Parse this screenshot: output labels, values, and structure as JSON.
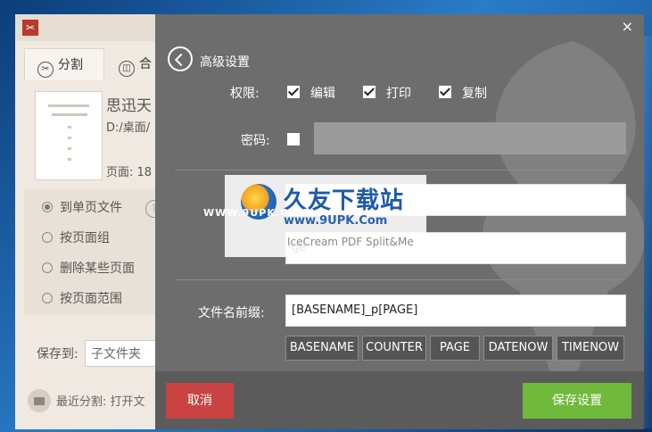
{
  "background_app": {
    "tabs": [
      {
        "label": "分割",
        "icon": "scissors-icon"
      },
      {
        "label": "合"
      }
    ],
    "file": {
      "name": "思迅天",
      "path": "D:/桌面/",
      "pages": "页面: 18"
    },
    "options": [
      "到单页文件",
      "按页面组",
      "删除某些页面",
      "按页面范围"
    ],
    "help": "?",
    "save_to": {
      "label": "保存到:",
      "value": "子文件夹"
    },
    "recent": "最近分割: 打开文"
  },
  "dialog": {
    "title": "高级设置",
    "close": "×",
    "permissions": {
      "label": "权限:",
      "items": [
        {
          "label": "编辑",
          "checked": true
        },
        {
          "label": "打印",
          "checked": true
        },
        {
          "label": "复制",
          "checked": true
        }
      ]
    },
    "password": {
      "label": "密码:",
      "checked": false,
      "value": ""
    },
    "field_a": {
      "value": ""
    },
    "field_b": {
      "value": "ge"
    },
    "filename_prefix": {
      "label": "文件名前缀:",
      "value": "[BASENAME]_p[PAGE]"
    },
    "tokens": [
      "BASENAME",
      "COUNTER",
      "PAGE",
      "DATENOW",
      "TIMENOW"
    ],
    "buttons": {
      "cancel": "取消",
      "save": "保存设置"
    }
  },
  "watermark": {
    "brand": "久友下载站",
    "url": "www.9UPK.Com",
    "left_text": "WWW.9UPK.COM",
    "faded_text": "IceCream PDF Split&Me"
  },
  "colors": {
    "dialog_bg": "#6d6d6d",
    "cancel": "#c94343",
    "save": "#6fba3a"
  }
}
